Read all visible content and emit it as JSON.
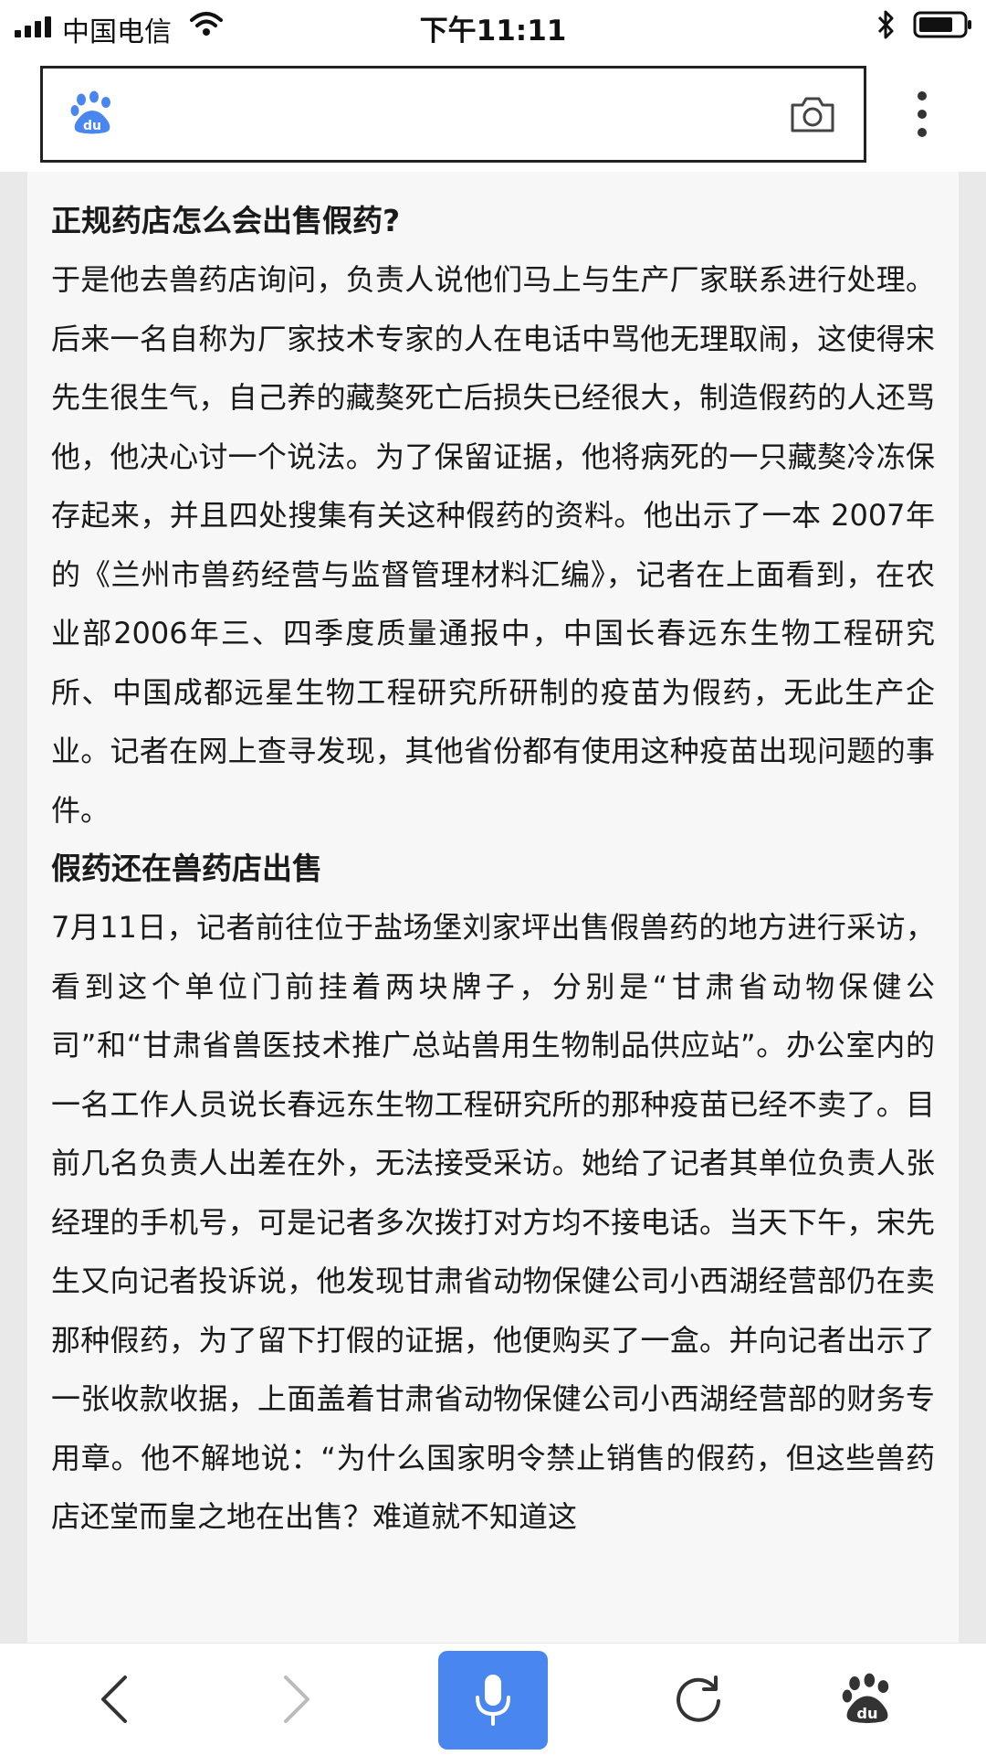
{
  "status_bar": {
    "carrier": "中国电信",
    "time": "下午11:11"
  },
  "search_bar": {
    "logo_text": "du",
    "icons": [
      "baidu-paw-icon",
      "camera-icon",
      "more-vertical-icon"
    ]
  },
  "article": {
    "heading1": "正规药店怎么会出售假药?",
    "paragraph1": "于是他去兽药店询问，负责人说他们马上与生产厂家联系进行处理。后来一名自称为厂家技术专家的人在电话中骂他无理取闹，这使得宋先生很生气，自己养的藏獒死亡后损失已经很大，制造假药的人还骂他，他决心讨一个说法。为了保留证据，他将病死的一只藏獒冷冻保存起来，并且四处搜集有关这种假药的资料。他出示了一本 2007年的《兰州市兽药经营与监督管理材料汇编》，记者在上面看到，在农业部2006年三、四季度质量通报中，中国长春远东生物工程研究所、中国成都远星生物工程研究所研制的疫苗为假药，无此生产企业。记者在网上查寻发现，其他省份都有使用这种疫苗出现问题的事件。",
    "heading2": "假药还在兽药店出售",
    "paragraph2": "7月11日，记者前往位于盐场堡刘家坪出售假兽药的地方进行采访，看到这个单位门前挂着两块牌子，分别是“甘肃省动物保健公司”和“甘肃省兽医技术推广总站兽用生物制品供应站”。办公室内的一名工作人员说长春远东生物工程研究所的那种疫苗已经不卖了。目前几名负责人出差在外，无法接受采访。她给了记者其单位负责人张经理的手机号，可是记者多次拨打对方均不接电话。当天下午，宋先生又向记者投诉说，他发现甘肃省动物保健公司小西湖经营部仍在卖那种假药，为了留下打假的证据，他便购买了一盒。并向记者出示了一张收款收据，上面盖着甘肃省动物保健公司小西湖经营部的财务专用章。他不解地说：“为什么国家明令禁止销售的假药，但这些兽药店还堂而皇之地在出售？难道就不知道这"
  },
  "bottom_bar": {
    "icons": [
      "back-icon",
      "forward-icon",
      "microphone-icon",
      "refresh-icon",
      "baidu-home-icon"
    ]
  },
  "colors": {
    "voice_button": "#4a86f0",
    "baidu_blue": "#4a86f0",
    "page_background": "#f7f7f7"
  }
}
